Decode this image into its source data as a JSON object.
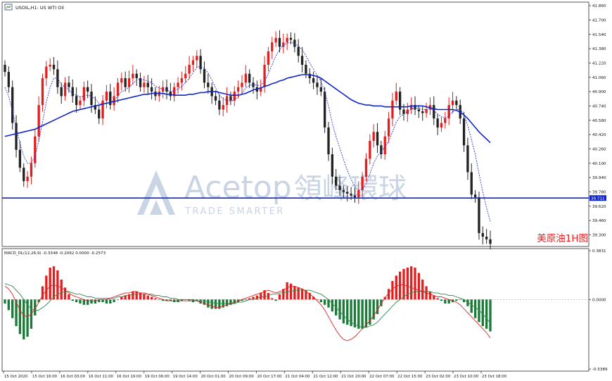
{
  "chart_data": [
    {
      "type": "candlestick",
      "title": "USOIL,H1: US WTI Oil",
      "symbol_label": "美原油1H图",
      "ylim": [
        39.17,
        41.9
      ],
      "price_ticks": [
        "41.860",
        "41.700",
        "41.540",
        "41.380",
        "41.220",
        "41.060",
        "40.900",
        "40.740",
        "40.580",
        "40.420",
        "40.260",
        "40.100",
        "39.940",
        "39.780",
        "39.620",
        "39.460",
        "39.300"
      ],
      "current_price_label": "39.711",
      "horizontal_line": 39.711,
      "date_ticks": [
        "15 Oct 2020",
        "15 Oct 16:00",
        "16 Oct 03:00",
        "16 Oct 11:00",
        "16 Oct 19:00",
        "19 Oct 06:00",
        "19 Oct 14:00",
        "20 Oct 01:00",
        "20 Oct 09:00",
        "20 Oct 17:00",
        "21 Oct 04:00",
        "21 Oct 12:00",
        "21 Oct 20:00",
        "22 Oct 07:00",
        "22 Oct 15:00",
        "23 Oct 02:00",
        "23 Oct 10:00",
        "23 Oct 18:00"
      ],
      "colors": {
        "bull": "#e02020",
        "bear": "#222222",
        "ma": "#1026c8",
        "ma_dotted": "#2a36d8",
        "hline": "#1026c8"
      },
      "closes": [
        41.12,
        40.95,
        40.55,
        40.25,
        40.05,
        39.9,
        39.95,
        40.1,
        40.4,
        40.75,
        41.05,
        41.18,
        41.2,
        41.15,
        40.95,
        40.85,
        41.0,
        40.95,
        40.85,
        40.75,
        40.8,
        40.95,
        40.9,
        40.75,
        40.7,
        40.6,
        40.8,
        40.9,
        40.75,
        40.85,
        41.0,
        41.05,
        40.95,
        41.05,
        41.1,
        41.05,
        40.95,
        41.0,
        40.95,
        40.9,
        40.85,
        40.9,
        40.95,
        40.9,
        40.85,
        40.95,
        41.0,
        41.05,
        41.1,
        41.2,
        41.25,
        41.3,
        41.15,
        41.0,
        40.95,
        40.85,
        40.8,
        40.7,
        40.75,
        40.85,
        40.8,
        40.9,
        40.95,
        41.0,
        41.1,
        41.0,
        40.95,
        40.9,
        40.95,
        41.2,
        41.35,
        41.45,
        41.5,
        41.4,
        41.45,
        41.5,
        41.48,
        41.4,
        41.3,
        41.2,
        41.1,
        41.05,
        41.0,
        40.95,
        40.9,
        40.5,
        40.2,
        39.95,
        39.85,
        39.8,
        39.78,
        39.76,
        39.74,
        39.72,
        39.8,
        39.95,
        40.15,
        40.35,
        40.45,
        40.3,
        40.2,
        40.4,
        40.6,
        40.8,
        40.9,
        40.7,
        40.65,
        40.7,
        40.75,
        40.7,
        40.68,
        40.66,
        40.7,
        40.75,
        40.6,
        40.5,
        40.55,
        40.6,
        40.75,
        40.8,
        40.75,
        40.6,
        40.3,
        40.0,
        39.75,
        39.72,
        39.32,
        39.28,
        39.25,
        39.2
      ],
      "sma_dotted": [
        40.95,
        40.85,
        40.68,
        40.5,
        40.32,
        40.18,
        40.1,
        40.1,
        40.18,
        40.35,
        40.56,
        40.78,
        40.95,
        41.05,
        41.05,
        40.98,
        40.95,
        40.92,
        40.88,
        40.86,
        40.84,
        40.85,
        40.86,
        40.85,
        40.82,
        40.77,
        40.76,
        40.77,
        40.78,
        40.8,
        40.85,
        40.9,
        40.92,
        40.95,
        40.99,
        41.03,
        41.04,
        41.03,
        41.02,
        41.0,
        40.96,
        40.94,
        40.93,
        40.92,
        40.9,
        40.91,
        40.93,
        40.96,
        41.0,
        41.05,
        41.11,
        41.17,
        41.18,
        41.16,
        41.11,
        41.03,
        40.94,
        40.86,
        40.82,
        40.8,
        40.79,
        40.81,
        40.84,
        40.88,
        40.94,
        40.97,
        40.98,
        40.97,
        40.97,
        41.02,
        41.1,
        41.2,
        41.3,
        41.37,
        41.42,
        41.44,
        41.45,
        41.44,
        41.41,
        41.37,
        41.3,
        41.22,
        41.15,
        41.08,
        41.02,
        40.9,
        40.74,
        40.55,
        40.4,
        40.27,
        40.14,
        40.02,
        39.92,
        39.84,
        39.8,
        39.81,
        39.87,
        39.98,
        40.1,
        40.18,
        40.23,
        40.28,
        40.35,
        40.45,
        40.56,
        40.62,
        40.65,
        40.68,
        40.7,
        40.72,
        40.71,
        40.7,
        40.7,
        40.71,
        40.69,
        40.65,
        40.62,
        40.6,
        40.63,
        40.67,
        40.7,
        40.7,
        40.64,
        40.52,
        40.36,
        40.2,
        39.98,
        39.78,
        39.6,
        39.45
      ],
      "sma_solid": [
        40.4,
        40.41,
        40.42,
        40.43,
        40.44,
        40.45,
        40.46,
        40.47,
        40.48,
        40.5,
        40.52,
        40.54,
        40.56,
        40.58,
        40.6,
        40.62,
        40.64,
        40.66,
        40.68,
        40.69,
        40.7,
        40.71,
        40.72,
        40.73,
        40.74,
        40.75,
        40.76,
        40.77,
        40.78,
        40.79,
        40.8,
        40.81,
        40.82,
        40.83,
        40.84,
        40.85,
        40.86,
        40.87,
        40.87,
        40.88,
        40.88,
        40.88,
        40.88,
        40.87,
        40.87,
        40.86,
        40.86,
        40.86,
        40.86,
        40.87,
        40.87,
        40.88,
        40.89,
        40.89,
        40.9,
        40.9,
        40.9,
        40.89,
        40.88,
        40.87,
        40.86,
        40.86,
        40.86,
        40.87,
        40.88,
        40.9,
        40.92,
        40.93,
        40.94,
        40.96,
        40.97,
        40.99,
        41.0,
        41.02,
        41.03,
        41.05,
        41.06,
        41.07,
        41.08,
        41.09,
        41.09,
        41.09,
        41.08,
        41.07,
        41.05,
        41.02,
        40.99,
        40.96,
        40.93,
        40.9,
        40.87,
        40.84,
        40.81,
        40.79,
        40.77,
        40.76,
        40.75,
        40.75,
        40.74,
        40.74,
        40.74,
        40.73,
        40.73,
        40.73,
        40.73,
        40.73,
        40.73,
        40.73,
        40.74,
        40.74,
        40.74,
        40.74,
        40.73,
        40.72,
        40.71,
        40.7,
        40.7,
        40.7,
        40.7,
        40.7,
        40.69,
        40.67,
        40.64,
        40.6,
        40.55,
        40.5,
        40.45,
        40.41,
        40.37,
        40.33
      ]
    },
    {
      "type": "bar",
      "title": "MACD_DL(12,26,9) -0.3348 -0.2062 0.0000 -0.2573",
      "ylim": [
        -0.5389,
        0.3831
      ],
      "y_ticks": [
        "0.3831",
        "0.0000",
        "-0.5389"
      ],
      "colors": {
        "positive": "#e02020",
        "negative": "#1a7a38",
        "dif": "#e02020",
        "dea": "#2a8a48"
      },
      "histogram": [
        -0.03,
        -0.08,
        -0.14,
        -0.2,
        -0.26,
        -0.3,
        -0.28,
        -0.22,
        -0.12,
        -0.02,
        0.1,
        0.18,
        0.24,
        0.25,
        0.22,
        0.15,
        0.09,
        0.04,
        -0.01,
        -0.02,
        -0.03,
        -0.04,
        -0.04,
        -0.03,
        -0.03,
        -0.02,
        -0.02,
        -0.03,
        -0.03,
        -0.02,
        0.0,
        0.02,
        0.03,
        0.04,
        0.06,
        0.06,
        0.05,
        0.04,
        0.03,
        0.02,
        0.01,
        0.0,
        -0.01,
        -0.01,
        -0.01,
        -0.02,
        -0.02,
        -0.01,
        0.0,
        -0.01,
        -0.02,
        -0.01,
        -0.03,
        -0.04,
        -0.06,
        -0.07,
        -0.07,
        -0.07,
        -0.06,
        -0.05,
        -0.04,
        -0.03,
        -0.02,
        -0.01,
        0.0,
        0.01,
        0.02,
        0.03,
        0.05,
        0.07,
        0.05,
        0.01,
        -0.01,
        0.04,
        0.08,
        0.13,
        0.12,
        0.1,
        0.09,
        0.08,
        0.07,
        0.05,
        0.02,
        0.0,
        -0.02,
        -0.04,
        -0.06,
        -0.09,
        -0.12,
        -0.15,
        -0.18,
        -0.19,
        -0.2,
        -0.21,
        -0.22,
        -0.22,
        -0.21,
        -0.19,
        -0.15,
        -0.11,
        -0.05,
        0.02,
        0.08,
        0.14,
        0.18,
        0.21,
        0.23,
        0.24,
        0.25,
        0.24,
        0.2,
        0.15,
        0.1,
        0.06,
        0.03,
        0.01,
        -0.01,
        -0.03,
        -0.03,
        -0.02,
        -0.01,
        0.0,
        -0.02,
        -0.05,
        -0.1,
        -0.14,
        -0.17,
        -0.2,
        -0.22,
        -0.24
      ],
      "dif": [
        0.1,
        0.08,
        0.04,
        -0.02,
        -0.08,
        -0.12,
        -0.13,
        -0.11,
        -0.07,
        -0.02,
        0.03,
        0.07,
        0.1,
        0.11,
        0.1,
        0.09,
        0.07,
        0.05,
        0.03,
        0.02,
        0.01,
        0.0,
        -0.01,
        -0.01,
        -0.01,
        0.0,
        0.0,
        0.0,
        0.01,
        0.02,
        0.03,
        0.04,
        0.05,
        0.05,
        0.06,
        0.06,
        0.05,
        0.05,
        0.04,
        0.03,
        0.02,
        0.01,
        0.0,
        -0.01,
        -0.01,
        -0.01,
        -0.01,
        -0.01,
        -0.01,
        -0.01,
        -0.01,
        -0.01,
        -0.02,
        -0.03,
        -0.04,
        -0.05,
        -0.06,
        -0.06,
        -0.05,
        -0.04,
        -0.03,
        -0.02,
        -0.01,
        0.0,
        0.01,
        0.02,
        0.03,
        0.04,
        0.05,
        0.06,
        0.07,
        0.06,
        0.05,
        0.06,
        0.07,
        0.09,
        0.1,
        0.1,
        0.09,
        0.08,
        0.06,
        0.04,
        0.02,
        -0.01,
        -0.04,
        -0.08,
        -0.13,
        -0.18,
        -0.23,
        -0.27,
        -0.3,
        -0.31,
        -0.3,
        -0.28,
        -0.25,
        -0.22,
        -0.19,
        -0.16,
        -0.12,
        -0.08,
        -0.03,
        0.01,
        0.05,
        0.08,
        0.1,
        0.11,
        0.11,
        0.1,
        0.09,
        0.08,
        0.07,
        0.06,
        0.05,
        0.04,
        0.03,
        0.02,
        0.02,
        0.01,
        0.0,
        -0.01,
        -0.02,
        -0.04,
        -0.07,
        -0.1,
        -0.13,
        -0.16,
        -0.19,
        -0.22,
        -0.25,
        -0.29
      ],
      "dea": [
        0.12,
        0.11,
        0.1,
        0.07,
        0.04,
        0.0,
        -0.04,
        -0.07,
        -0.08,
        -0.08,
        -0.06,
        -0.04,
        -0.01,
        0.02,
        0.04,
        0.05,
        0.06,
        0.06,
        0.05,
        0.04,
        0.04,
        0.03,
        0.02,
        0.02,
        0.01,
        0.01,
        0.01,
        0.01,
        0.01,
        0.01,
        0.02,
        0.02,
        0.03,
        0.03,
        0.04,
        0.04,
        0.04,
        0.04,
        0.04,
        0.04,
        0.03,
        0.03,
        0.02,
        0.02,
        0.01,
        0.01,
        0.0,
        0.0,
        0.0,
        0.0,
        0.0,
        -0.01,
        -0.01,
        -0.01,
        -0.02,
        -0.02,
        -0.03,
        -0.03,
        -0.03,
        -0.03,
        -0.03,
        -0.03,
        -0.02,
        -0.02,
        -0.01,
        0.0,
        0.0,
        0.01,
        0.02,
        0.02,
        0.03,
        0.04,
        0.04,
        0.05,
        0.05,
        0.06,
        0.06,
        0.07,
        0.07,
        0.07,
        0.07,
        0.07,
        0.06,
        0.05,
        0.04,
        0.02,
        0.0,
        -0.03,
        -0.06,
        -0.09,
        -0.12,
        -0.15,
        -0.17,
        -0.19,
        -0.2,
        -0.21,
        -0.21,
        -0.2,
        -0.19,
        -0.17,
        -0.14,
        -0.11,
        -0.08,
        -0.05,
        -0.02,
        0.0,
        0.02,
        0.04,
        0.05,
        0.06,
        0.06,
        0.06,
        0.06,
        0.06,
        0.05,
        0.05,
        0.04,
        0.04,
        0.03,
        0.03,
        0.02,
        0.01,
        0.0,
        -0.02,
        -0.04,
        -0.06,
        -0.08,
        -0.11,
        -0.14,
        -0.18
      ]
    }
  ],
  "watermark": {
    "brand_latin": "Acetop",
    "brand_cn": "領峰環球",
    "tagline": "TRADE SMARTER",
    "color": "#9db1cf"
  }
}
